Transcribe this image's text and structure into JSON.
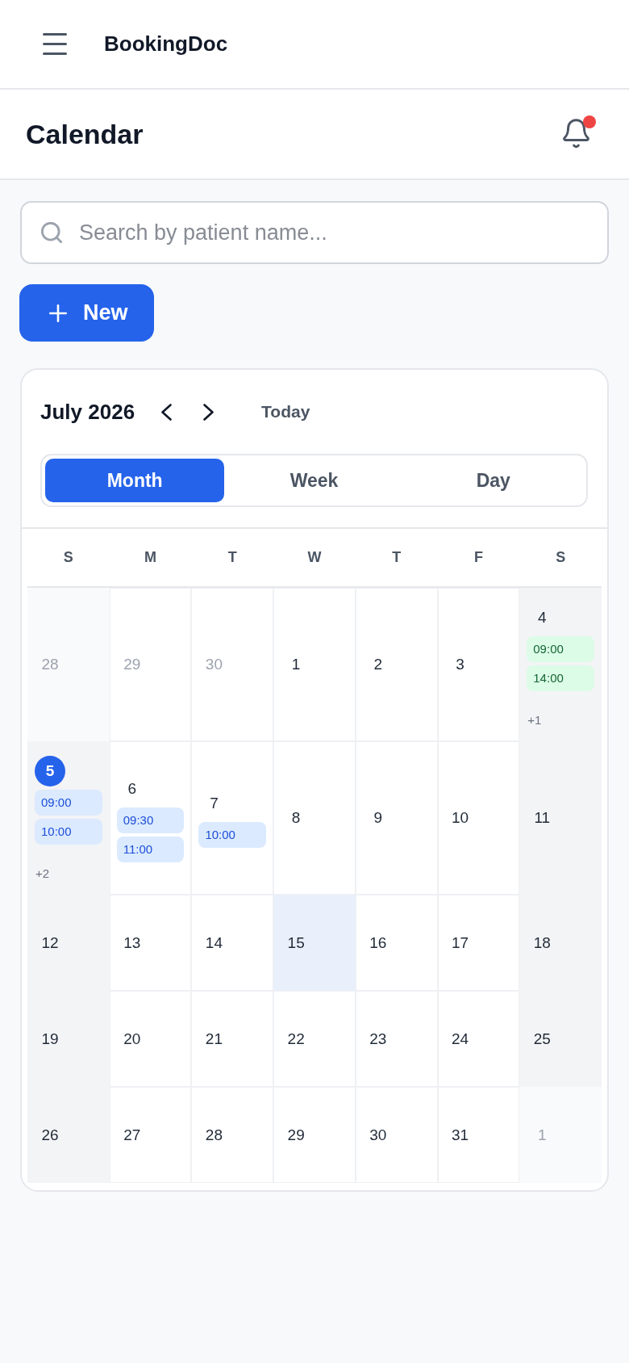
{
  "app_bar": {
    "title": "BookingDoc"
  },
  "page_header": {
    "title": "Calendar",
    "notifications_unread": true
  },
  "search": {
    "placeholder": "Search by patient name..."
  },
  "new_button": {
    "label": "New"
  },
  "calendar": {
    "month_label": "July 2026",
    "today_button": "Today",
    "views": [
      {
        "label": "Month",
        "selected": true
      },
      {
        "label": "Week",
        "selected": false
      },
      {
        "label": "Day",
        "selected": false
      }
    ],
    "weekdays": [
      "S",
      "M",
      "T",
      "W",
      "T",
      "F",
      "S"
    ],
    "weeks": [
      [
        {
          "day": "28",
          "outside": true,
          "today": false,
          "highlighted": false
        },
        {
          "day": "29",
          "outside": true,
          "today": false,
          "highlighted": false
        },
        {
          "day": "30",
          "outside": true,
          "today": false,
          "highlighted": false
        },
        {
          "day": "1",
          "outside": false,
          "today": false,
          "highlighted": false
        },
        {
          "day": "2",
          "outside": false,
          "today": false,
          "highlighted": false
        },
        {
          "day": "3",
          "outside": false,
          "today": false,
          "highlighted": false
        },
        {
          "day": "4",
          "outside": false,
          "today": false,
          "highlighted": false,
          "events": [
            {
              "time": "09:00",
              "color": "#dcfce7"
            },
            {
              "time": "14:00",
              "color": "#dcfce7"
            }
          ],
          "more": "+1"
        }
      ],
      [
        {
          "day": "5",
          "outside": false,
          "today": true,
          "highlighted": false,
          "events": [
            {
              "time": "09:00",
              "color": "#dbeafe"
            },
            {
              "time": "10:00",
              "color": "#dbeafe"
            }
          ],
          "more": "+2"
        },
        {
          "day": "6",
          "outside": false,
          "today": false,
          "highlighted": false,
          "events": [
            {
              "time": "09:30",
              "color": "#dbeafe"
            },
            {
              "time": "11:00",
              "color": "#dbeafe"
            }
          ]
        },
        {
          "day": "7",
          "outside": false,
          "today": false,
          "highlighted": false,
          "events": [
            {
              "time": "10:00",
              "color": "#dbeafe"
            }
          ]
        },
        {
          "day": "8",
          "outside": false,
          "today": false,
          "highlighted": false
        },
        {
          "day": "9",
          "outside": false,
          "today": false,
          "highlighted": false
        },
        {
          "day": "10",
          "outside": false,
          "today": false,
          "highlighted": false
        },
        {
          "day": "11",
          "outside": false,
          "today": false,
          "highlighted": false
        }
      ],
      [
        {
          "day": "12",
          "outside": false,
          "today": false,
          "highlighted": false
        },
        {
          "day": "13",
          "outside": false,
          "today": false,
          "highlighted": false
        },
        {
          "day": "14",
          "outside": false,
          "today": false,
          "highlighted": false
        },
        {
          "day": "15",
          "outside": false,
          "today": false,
          "highlighted": true
        },
        {
          "day": "16",
          "outside": false,
          "today": false,
          "highlighted": false
        },
        {
          "day": "17",
          "outside": false,
          "today": false,
          "highlighted": false
        },
        {
          "day": "18",
          "outside": false,
          "today": false,
          "highlighted": false
        }
      ],
      [
        {
          "day": "19",
          "outside": false,
          "today": false,
          "highlighted": false
        },
        {
          "day": "20",
          "outside": false,
          "today": false,
          "highlighted": false
        },
        {
          "day": "21",
          "outside": false,
          "today": false,
          "highlighted": false
        },
        {
          "day": "22",
          "outside": false,
          "today": false,
          "highlighted": false
        },
        {
          "day": "23",
          "outside": false,
          "today": false,
          "highlighted": false
        },
        {
          "day": "24",
          "outside": false,
          "today": false,
          "highlighted": false
        },
        {
          "day": "25",
          "outside": false,
          "today": false,
          "highlighted": false
        }
      ],
      [
        {
          "day": "26",
          "outside": false,
          "today": false,
          "highlighted": false
        },
        {
          "day": "27",
          "outside": false,
          "today": false,
          "highlighted": false
        },
        {
          "day": "28",
          "outside": false,
          "today": false,
          "highlighted": false
        },
        {
          "day": "29",
          "outside": false,
          "today": false,
          "highlighted": false
        },
        {
          "day": "30",
          "outside": false,
          "today": false,
          "highlighted": false
        },
        {
          "day": "31",
          "outside": false,
          "today": false,
          "highlighted": false
        },
        {
          "day": "1",
          "outside": true,
          "today": false,
          "highlighted": false
        }
      ]
    ]
  }
}
